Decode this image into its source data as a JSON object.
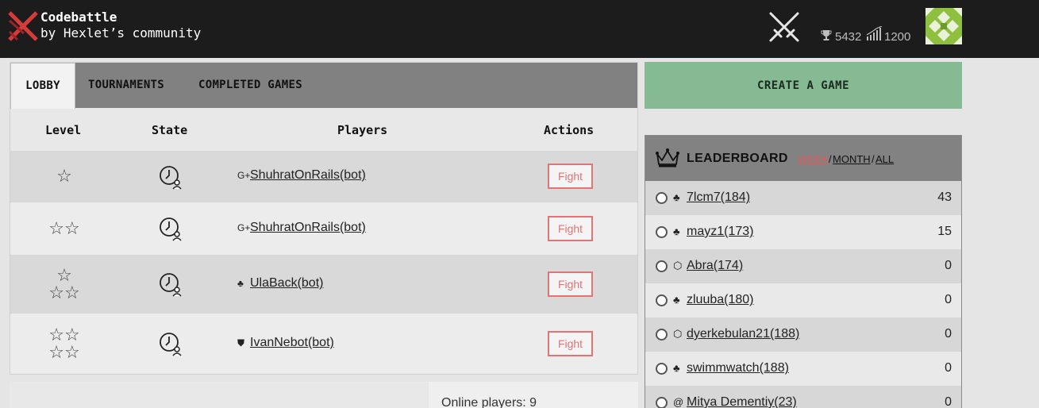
{
  "brand": {
    "title": "Codebattle",
    "subtitle": "by Hexlet’s community"
  },
  "user": {
    "rank": "5432",
    "rating": "1200"
  },
  "tabs": [
    {
      "label": "LOBBY",
      "active": true
    },
    {
      "label": "TOURNAMENTS",
      "active": false
    },
    {
      "label": "COMPLETED GAMES",
      "active": false
    }
  ],
  "table": {
    "headers": [
      "Level",
      "State",
      "Players",
      "Actions"
    ],
    "rows": [
      {
        "stars_top": "☆",
        "stars_bottom": "",
        "lang_icon": "cpp-icon",
        "lang_glyph": "G+",
        "player": "ShuhratOnRails(bot)",
        "action": "Fight"
      },
      {
        "stars_top": "☆☆",
        "stars_bottom": "",
        "lang_icon": "cpp-icon",
        "lang_glyph": "G+",
        "player": "ShuhratOnRails(bot)",
        "action": "Fight"
      },
      {
        "stars_top": "☆",
        "stars_bottom": "☆☆",
        "lang_icon": "python-icon",
        "lang_glyph": "♣",
        "player": "UlaBack(bot)",
        "action": "Fight"
      },
      {
        "stars_top": "☆☆",
        "stars_bottom": "☆☆",
        "lang_icon": "shield-icon",
        "lang_glyph": "⛊",
        "player": "IvanNebot(bot)",
        "action": "Fight"
      }
    ]
  },
  "online": {
    "text": "Online players: 9"
  },
  "create_game": {
    "label": "CREATE A GAME"
  },
  "leaderboard": {
    "title": "LEADERBOARD",
    "periods": [
      {
        "label": "WEEK",
        "active": true
      },
      {
        "label": "MONTH",
        "active": false
      },
      {
        "label": "ALL",
        "active": false
      }
    ],
    "separator": "/",
    "rows": [
      {
        "lang_icon": "python-icon",
        "lang_glyph": "♣",
        "name": "7lcm7(184)",
        "score": "43"
      },
      {
        "lang_icon": "python-icon",
        "lang_glyph": "♣",
        "name": "mayz1(173)",
        "score": "15"
      },
      {
        "lang_icon": "hexagon-icon",
        "lang_glyph": "⬡",
        "name": "Abra(174)",
        "score": "0"
      },
      {
        "lang_icon": "python-icon",
        "lang_glyph": "♣",
        "name": "zluuba(180)",
        "score": "0"
      },
      {
        "lang_icon": "hexagon-icon",
        "lang_glyph": "⬡",
        "name": "dyerkebulan21(188)",
        "score": "0"
      },
      {
        "lang_icon": "python-icon",
        "lang_glyph": "♣",
        "name": "swimmwatch(188)",
        "score": "0"
      },
      {
        "lang_icon": "at-icon",
        "lang_glyph": "@",
        "name": "Mitya Dementiy(23)",
        "score": "0"
      }
    ]
  },
  "colors": {
    "header_bg": "#1c1c1c",
    "accent_red": "#e57373",
    "create_green": "#86ba93",
    "tab_bar": "#818181",
    "week_active": "#e05a5a",
    "logo_red": "#d63b3b"
  }
}
